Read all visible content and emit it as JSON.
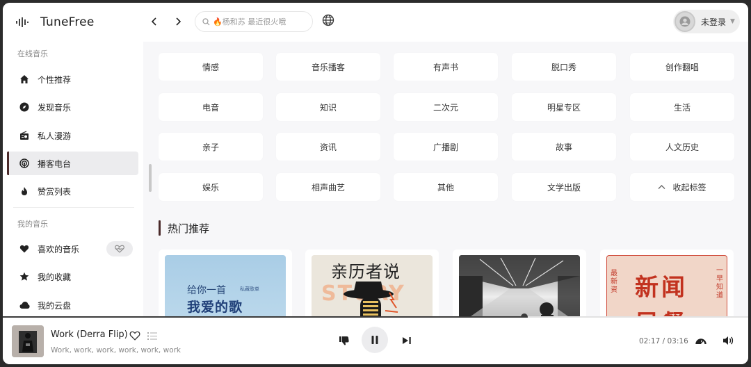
{
  "app": {
    "name": "TuneFree"
  },
  "search": {
    "placeholder": "🔥杨和苏 最近很火哦"
  },
  "user": {
    "name": "未登录"
  },
  "sidebar": {
    "online_label": "在线音乐",
    "online_items": [
      {
        "label": "个性推荐",
        "icon": "home-icon"
      },
      {
        "label": "发现音乐",
        "icon": "compass-icon"
      },
      {
        "label": "私人漫游",
        "icon": "radio-icon"
      },
      {
        "label": "播客电台",
        "icon": "podcast-icon",
        "active": true
      },
      {
        "label": "赞赏列表",
        "icon": "fire-icon"
      }
    ],
    "mine_label": "我的音乐",
    "mine_items": [
      {
        "label": "喜欢的音乐",
        "icon": "heart-icon"
      },
      {
        "label": "我的收藏",
        "icon": "star-icon"
      },
      {
        "label": "我的云盘",
        "icon": "cloud-icon"
      }
    ]
  },
  "tags": [
    [
      "情感",
      "音乐播客",
      "有声书",
      "脱口秀",
      "创作翻唱"
    ],
    [
      "电音",
      "知识",
      "二次元",
      "明星专区",
      "生活"
    ],
    [
      "亲子",
      "资讯",
      "广播剧",
      "故事",
      "人文历史"
    ],
    [
      "娱乐",
      "相声曲艺",
      "其他",
      "文学出版",
      "收起标签"
    ]
  ],
  "hot": {
    "title": "热门推荐",
    "covers": [
      {
        "line1": "给你一首",
        "line1b": "私藏歌单",
        "line2": "我爱的歌"
      },
      {
        "title": "亲历者说",
        "bg": "STORY"
      },
      {
        "scene": "photo"
      },
      {
        "title": "新闻",
        "subtitle": "早餐",
        "left": "最新资",
        "right": "一早知道"
      }
    ]
  },
  "player": {
    "title": "Work (Derra Flip)",
    "artist": "Work, work, work, work, work, work",
    "current_time": "02:17",
    "separator": "/",
    "total_time": "03:16",
    "progress": 0.7
  },
  "colors": {
    "accent": "#4a2a2a",
    "background": "#f7f7f9"
  }
}
